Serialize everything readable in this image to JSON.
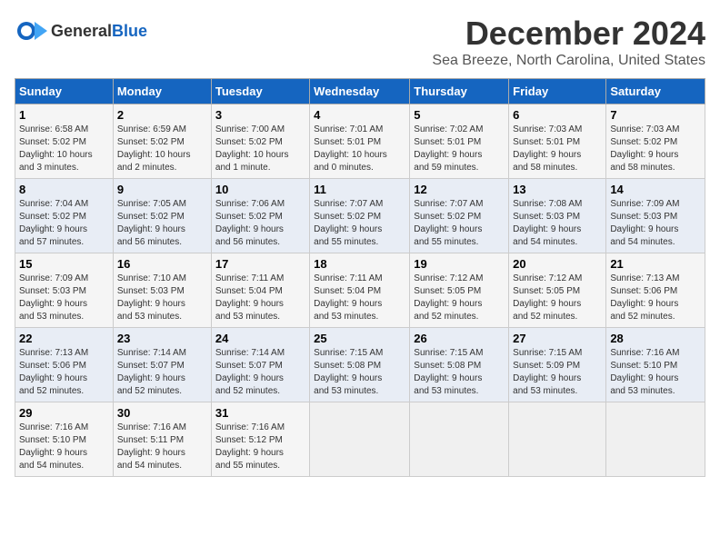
{
  "header": {
    "logo_general": "General",
    "logo_blue": "Blue",
    "month_title": "December 2024",
    "location": "Sea Breeze, North Carolina, United States"
  },
  "days_of_week": [
    "Sunday",
    "Monday",
    "Tuesday",
    "Wednesday",
    "Thursday",
    "Friday",
    "Saturday"
  ],
  "weeks": [
    [
      {
        "day": "1",
        "info": "Sunrise: 6:58 AM\nSunset: 5:02 PM\nDaylight: 10 hours\nand 3 minutes."
      },
      {
        "day": "2",
        "info": "Sunrise: 6:59 AM\nSunset: 5:02 PM\nDaylight: 10 hours\nand 2 minutes."
      },
      {
        "day": "3",
        "info": "Sunrise: 7:00 AM\nSunset: 5:02 PM\nDaylight: 10 hours\nand 1 minute."
      },
      {
        "day": "4",
        "info": "Sunrise: 7:01 AM\nSunset: 5:01 PM\nDaylight: 10 hours\nand 0 minutes."
      },
      {
        "day": "5",
        "info": "Sunrise: 7:02 AM\nSunset: 5:01 PM\nDaylight: 9 hours\nand 59 minutes."
      },
      {
        "day": "6",
        "info": "Sunrise: 7:03 AM\nSunset: 5:01 PM\nDaylight: 9 hours\nand 58 minutes."
      },
      {
        "day": "7",
        "info": "Sunrise: 7:03 AM\nSunset: 5:02 PM\nDaylight: 9 hours\nand 58 minutes."
      }
    ],
    [
      {
        "day": "8",
        "info": "Sunrise: 7:04 AM\nSunset: 5:02 PM\nDaylight: 9 hours\nand 57 minutes."
      },
      {
        "day": "9",
        "info": "Sunrise: 7:05 AM\nSunset: 5:02 PM\nDaylight: 9 hours\nand 56 minutes."
      },
      {
        "day": "10",
        "info": "Sunrise: 7:06 AM\nSunset: 5:02 PM\nDaylight: 9 hours\nand 56 minutes."
      },
      {
        "day": "11",
        "info": "Sunrise: 7:07 AM\nSunset: 5:02 PM\nDaylight: 9 hours\nand 55 minutes."
      },
      {
        "day": "12",
        "info": "Sunrise: 7:07 AM\nSunset: 5:02 PM\nDaylight: 9 hours\nand 55 minutes."
      },
      {
        "day": "13",
        "info": "Sunrise: 7:08 AM\nSunset: 5:03 PM\nDaylight: 9 hours\nand 54 minutes."
      },
      {
        "day": "14",
        "info": "Sunrise: 7:09 AM\nSunset: 5:03 PM\nDaylight: 9 hours\nand 54 minutes."
      }
    ],
    [
      {
        "day": "15",
        "info": "Sunrise: 7:09 AM\nSunset: 5:03 PM\nDaylight: 9 hours\nand 53 minutes."
      },
      {
        "day": "16",
        "info": "Sunrise: 7:10 AM\nSunset: 5:03 PM\nDaylight: 9 hours\nand 53 minutes."
      },
      {
        "day": "17",
        "info": "Sunrise: 7:11 AM\nSunset: 5:04 PM\nDaylight: 9 hours\nand 53 minutes."
      },
      {
        "day": "18",
        "info": "Sunrise: 7:11 AM\nSunset: 5:04 PM\nDaylight: 9 hours\nand 53 minutes."
      },
      {
        "day": "19",
        "info": "Sunrise: 7:12 AM\nSunset: 5:05 PM\nDaylight: 9 hours\nand 52 minutes."
      },
      {
        "day": "20",
        "info": "Sunrise: 7:12 AM\nSunset: 5:05 PM\nDaylight: 9 hours\nand 52 minutes."
      },
      {
        "day": "21",
        "info": "Sunrise: 7:13 AM\nSunset: 5:06 PM\nDaylight: 9 hours\nand 52 minutes."
      }
    ],
    [
      {
        "day": "22",
        "info": "Sunrise: 7:13 AM\nSunset: 5:06 PM\nDaylight: 9 hours\nand 52 minutes."
      },
      {
        "day": "23",
        "info": "Sunrise: 7:14 AM\nSunset: 5:07 PM\nDaylight: 9 hours\nand 52 minutes."
      },
      {
        "day": "24",
        "info": "Sunrise: 7:14 AM\nSunset: 5:07 PM\nDaylight: 9 hours\nand 52 minutes."
      },
      {
        "day": "25",
        "info": "Sunrise: 7:15 AM\nSunset: 5:08 PM\nDaylight: 9 hours\nand 53 minutes."
      },
      {
        "day": "26",
        "info": "Sunrise: 7:15 AM\nSunset: 5:08 PM\nDaylight: 9 hours\nand 53 minutes."
      },
      {
        "day": "27",
        "info": "Sunrise: 7:15 AM\nSunset: 5:09 PM\nDaylight: 9 hours\nand 53 minutes."
      },
      {
        "day": "28",
        "info": "Sunrise: 7:16 AM\nSunset: 5:10 PM\nDaylight: 9 hours\nand 53 minutes."
      }
    ],
    [
      {
        "day": "29",
        "info": "Sunrise: 7:16 AM\nSunset: 5:10 PM\nDaylight: 9 hours\nand 54 minutes."
      },
      {
        "day": "30",
        "info": "Sunrise: 7:16 AM\nSunset: 5:11 PM\nDaylight: 9 hours\nand 54 minutes."
      },
      {
        "day": "31",
        "info": "Sunrise: 7:16 AM\nSunset: 5:12 PM\nDaylight: 9 hours\nand 55 minutes."
      },
      {
        "day": "",
        "info": ""
      },
      {
        "day": "",
        "info": ""
      },
      {
        "day": "",
        "info": ""
      },
      {
        "day": "",
        "info": ""
      }
    ]
  ]
}
